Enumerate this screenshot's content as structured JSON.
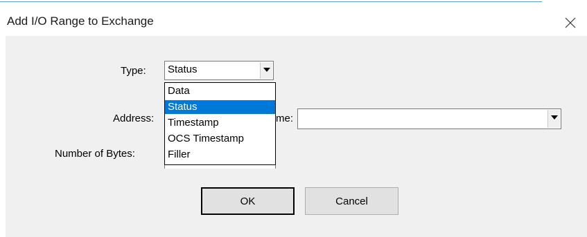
{
  "window": {
    "title": "Add I/O Range to Exchange"
  },
  "form": {
    "type_label": "Type:",
    "type_value": "Status",
    "address_label": "Address:",
    "name_label_partial": "me:",
    "name_value": "",
    "bytes_label": "Number of Bytes:"
  },
  "dropdown": {
    "options": [
      "Data",
      "Status",
      "Timestamp",
      "OCS Timestamp",
      "Filler"
    ],
    "selected": "Status"
  },
  "buttons": {
    "ok": "OK",
    "cancel": "Cancel"
  },
  "colors": {
    "selection": "#0078d7",
    "dialog_bg": "#f0f0f0",
    "accent_line": "#5b9bd5"
  }
}
